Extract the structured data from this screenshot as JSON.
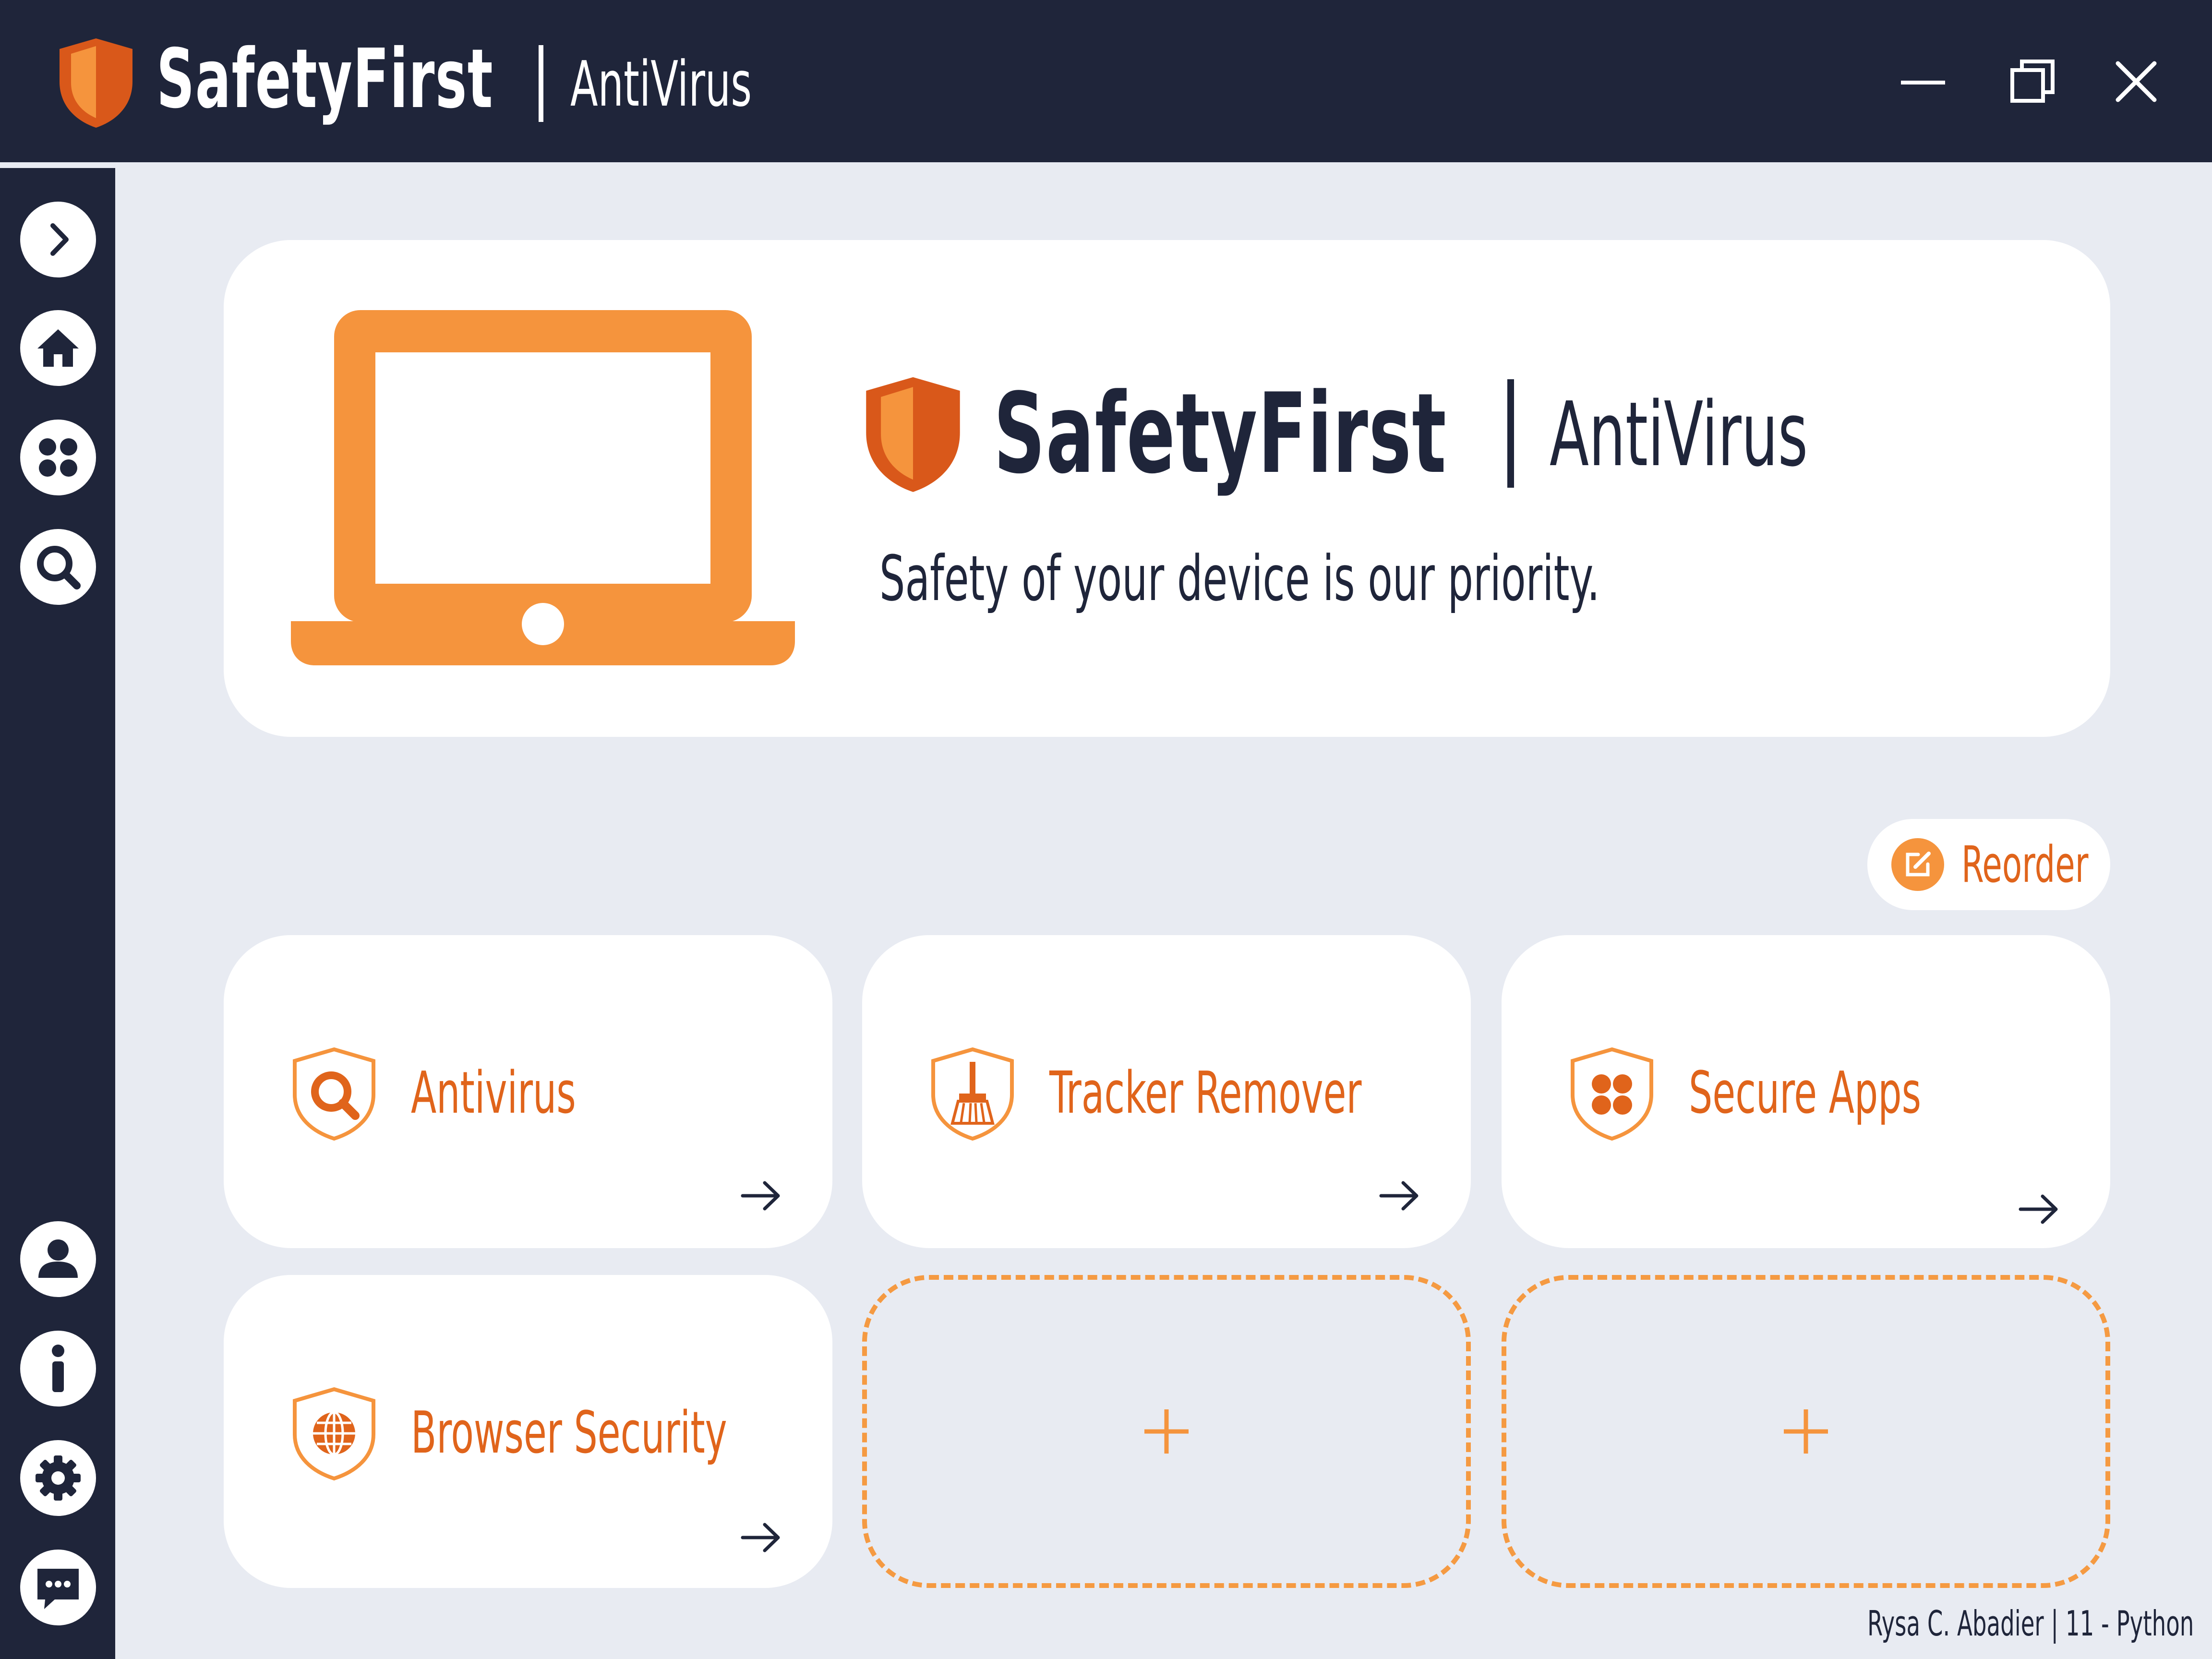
{
  "app": {
    "brand": "SafetyFirst",
    "product": "AntiVirus",
    "tagline": "Safety of your device is our priority."
  },
  "window_controls": [
    "minimize-icon",
    "maximize-icon",
    "close-icon"
  ],
  "sidebar": {
    "top_items": [
      "expand-icon",
      "home-icon",
      "apps-icon",
      "search-icon"
    ],
    "bottom_items": [
      "account-icon",
      "info-icon",
      "settings-icon",
      "chat-icon"
    ]
  },
  "reorder": {
    "label": "Reorder",
    "icon": "edit-icon"
  },
  "cards": [
    {
      "label": "Antivirus",
      "icon": "shield-search-icon"
    },
    {
      "label": "Tracker Remover",
      "icon": "shield-broom-icon"
    },
    {
      "label": "Secure Apps",
      "icon": "shield-apps-icon"
    },
    {
      "label": "Browser Security",
      "icon": "shield-globe-icon"
    }
  ],
  "empty_slots": [
    "+",
    "+"
  ],
  "footer": {
    "credit": "Rysa C. Abadier | 11 - Python"
  },
  "colors": {
    "navy": "#1f253a",
    "orange": "#f5943d",
    "orange_dark": "#e0641b",
    "background": "#e8ebf2",
    "card": "#ffffff"
  }
}
